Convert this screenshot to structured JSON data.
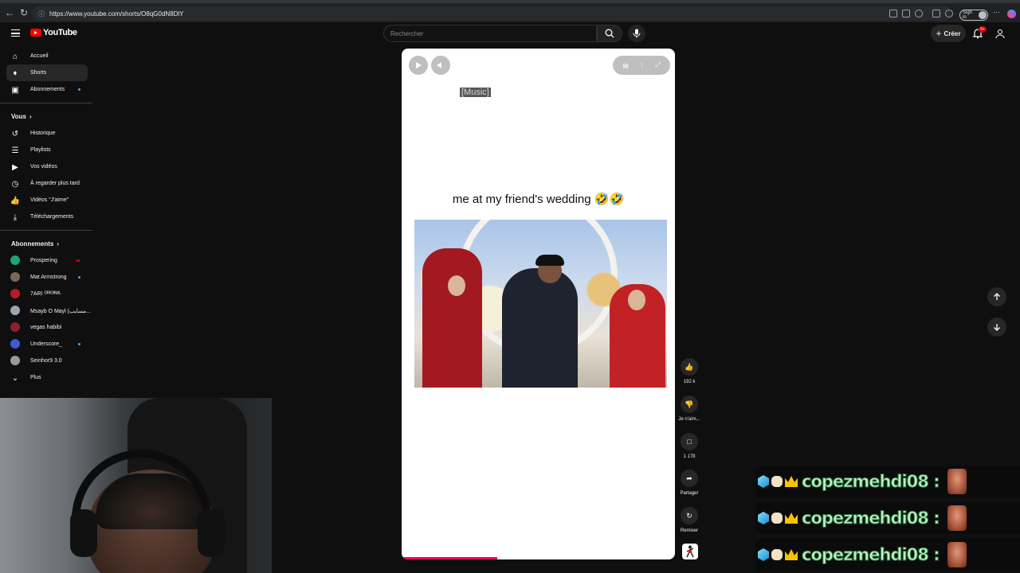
{
  "browser": {
    "url": "https://www.youtube.com/shorts/O8qG0dN8DlY",
    "signin_label": "Sign in"
  },
  "header": {
    "logo_text": "YouTube",
    "search_placeholder": "Rechercher",
    "create_label": "Créer",
    "notification_count": "9+"
  },
  "sidebar": {
    "main": [
      {
        "label": "Accueil",
        "icon": "home-icon"
      },
      {
        "label": "Shorts",
        "icon": "shorts-icon"
      },
      {
        "label": "Abonnements",
        "icon": "subscriptions-icon"
      }
    ],
    "you_heading": "Vous",
    "you_items": [
      {
        "label": "Historique",
        "icon": "history-icon"
      },
      {
        "label": "Playlists",
        "icon": "playlists-icon"
      },
      {
        "label": "Vos vidéos",
        "icon": "your-videos-icon"
      },
      {
        "label": "À regarder plus tard",
        "icon": "watch-later-icon"
      },
      {
        "label": "Vidéos \"J'aime\"",
        "icon": "liked-videos-icon"
      },
      {
        "label": "Téléchargements",
        "icon": "downloads-icon"
      }
    ],
    "subs_heading": "Abonnements",
    "subscriptions": [
      {
        "label": "Prospering",
        "color": "#1fa37a"
      },
      {
        "label": "Mat Armstrong",
        "color": "#7a6a55"
      },
      {
        "label": "7ARI ᴼᴿᴵᴳᴵᴺᴬᴸ",
        "color": "#b51d24"
      },
      {
        "label": "Msayb O Mayl (مسايب...",
        "color": "#9aa5b0"
      },
      {
        "label": "vegas habibi",
        "color": "#8a2030"
      },
      {
        "label": "Underscore_",
        "color": "#3b5bd1"
      },
      {
        "label": "Seinhor9 3.0",
        "color": "#9a9a9a"
      }
    ],
    "more_label": "Plus"
  },
  "player": {
    "caption": "[Music]",
    "video_title": "me at my friend's wedding 🤣🤣",
    "progress_fraction": 0.35
  },
  "actions": {
    "like_count": "192 k",
    "dislike_label": "Je n'aim...",
    "comment_count": "1 178",
    "share_label": "Partager",
    "remix_label": "Remixer"
  },
  "chat": {
    "messages": [
      {
        "name": "copezmehdi08 :"
      },
      {
        "name": "copezmehdi08 :"
      },
      {
        "name": "copezmehdi08 :"
      }
    ]
  }
}
